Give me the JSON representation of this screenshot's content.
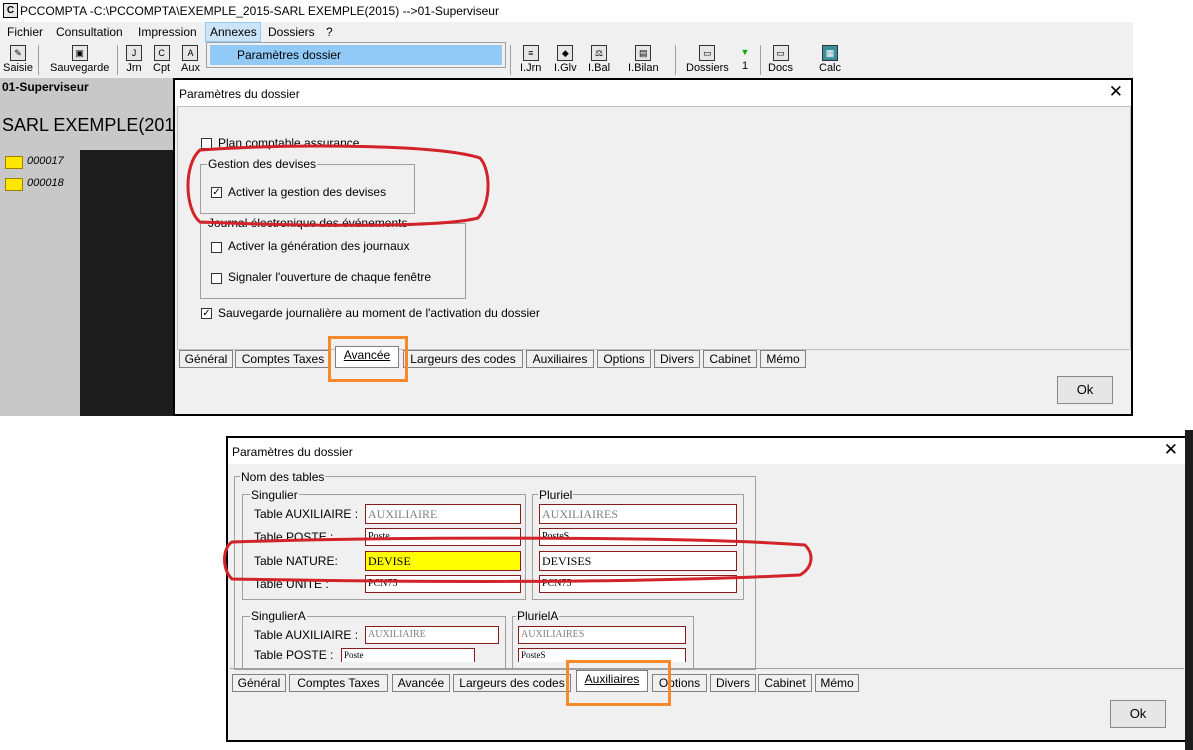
{
  "app": {
    "title": "PCCOMPTA -C:\\PCCOMPTA\\EXEMPLE_2015-SARL EXEMPLE(2015) -->01-Superviseur",
    "logo": "C",
    "menu": [
      "Fichier",
      "Consultation",
      "Impression",
      "Annexes",
      "Dossiers",
      "?"
    ],
    "dropdown_item": "Paramètres dossier",
    "toolbar": {
      "saisie": "Saisie",
      "sauvegarde": "Sauvegarde",
      "jrn": "Jrn",
      "cpt": "Cpt",
      "aux": "Aux",
      "ijrn": "I.Jrn",
      "iglv": "I.Glv",
      "ibal": "I.Bal",
      "ibilan": "I.Bilan",
      "dossiers": "Dossiers",
      "one": "1",
      "docs": "Docs",
      "calc": "Calc"
    },
    "user": "01-Superviseur",
    "company": "SARL EXEMPLE(201",
    "folders": [
      "000017",
      "000018"
    ]
  },
  "dialog1": {
    "title": "Paramètres du dossier",
    "close": "✕",
    "plan_assurance": "Plan comptable assurance",
    "devises_group": "Gestion des devises",
    "activer_devises": "Activer la gestion des devises",
    "journal_group": "Journal électronique des événements",
    "activer_journaux": "Activer la génération des journaux",
    "signaler_fenetre": "Signaler l'ouverture de chaque fenêtre",
    "sauvegarde_journaliere": "Sauvegarde journalière au moment de l'activation du dossier",
    "tabs": [
      "Général",
      "Comptes Taxes",
      "Avancée",
      "Largeurs des codes",
      "Auxiliaires",
      "Options",
      "Divers",
      "Cabinet",
      "Mémo"
    ],
    "ok": "Ok"
  },
  "dialog2": {
    "title": "Paramètres du dossier",
    "close": "✕",
    "nom_tables": "Nom des tables",
    "singulier": "Singulier",
    "pluriel": "Pluriel",
    "singulierA": "SingulierA",
    "plurielA": "PlurielA",
    "labels": {
      "aux": "Table AUXILIAIRE :",
      "poste": "Table POSTE :",
      "nature": "Table NATURE:",
      "unite": "Table UNITE :"
    },
    "singular_values": {
      "aux": "AUXILIAIRE",
      "poste": "Poste",
      "nature": "DEVISE",
      "unite": "PCN75"
    },
    "plural_values": {
      "aux": "AUXILIAIRES",
      "poste": "PosteS",
      "nature": "DEVISES",
      "unite": "PCN75"
    },
    "singA_values": {
      "aux": "AUXILIAIRE",
      "poste": "Poste"
    },
    "plurA_values": {
      "aux": "AUXILIAIRES",
      "poste": "PosteS"
    },
    "tabs": [
      "Général",
      "Comptes Taxes",
      "Avancée",
      "Largeurs des codes",
      "Auxiliaires",
      "Options",
      "Divers",
      "Cabinet",
      "Mémo"
    ],
    "ok": "Ok"
  },
  "colors": {
    "annotation_red": "#d2232a",
    "annotation_orange": "#f58a2a",
    "highlight_yellow": "#ffff00"
  }
}
